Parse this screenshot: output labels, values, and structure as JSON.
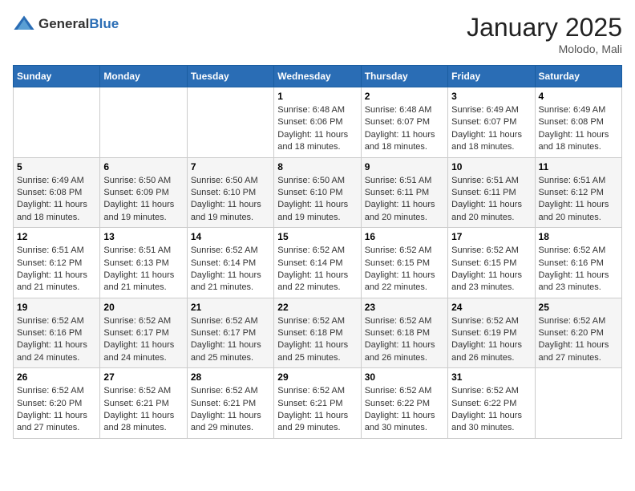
{
  "header": {
    "logo_general": "General",
    "logo_blue": "Blue",
    "month_year": "January 2025",
    "location": "Molodo, Mali"
  },
  "days_of_week": [
    "Sunday",
    "Monday",
    "Tuesday",
    "Wednesday",
    "Thursday",
    "Friday",
    "Saturday"
  ],
  "weeks": [
    [
      {
        "day": "",
        "sunrise": "",
        "sunset": "",
        "daylight": ""
      },
      {
        "day": "",
        "sunrise": "",
        "sunset": "",
        "daylight": ""
      },
      {
        "day": "",
        "sunrise": "",
        "sunset": "",
        "daylight": ""
      },
      {
        "day": "1",
        "sunrise": "Sunrise: 6:48 AM",
        "sunset": "Sunset: 6:06 PM",
        "daylight": "Daylight: 11 hours and 18 minutes."
      },
      {
        "day": "2",
        "sunrise": "Sunrise: 6:48 AM",
        "sunset": "Sunset: 6:07 PM",
        "daylight": "Daylight: 11 hours and 18 minutes."
      },
      {
        "day": "3",
        "sunrise": "Sunrise: 6:49 AM",
        "sunset": "Sunset: 6:07 PM",
        "daylight": "Daylight: 11 hours and 18 minutes."
      },
      {
        "day": "4",
        "sunrise": "Sunrise: 6:49 AM",
        "sunset": "Sunset: 6:08 PM",
        "daylight": "Daylight: 11 hours and 18 minutes."
      }
    ],
    [
      {
        "day": "5",
        "sunrise": "Sunrise: 6:49 AM",
        "sunset": "Sunset: 6:08 PM",
        "daylight": "Daylight: 11 hours and 18 minutes."
      },
      {
        "day": "6",
        "sunrise": "Sunrise: 6:50 AM",
        "sunset": "Sunset: 6:09 PM",
        "daylight": "Daylight: 11 hours and 19 minutes."
      },
      {
        "day": "7",
        "sunrise": "Sunrise: 6:50 AM",
        "sunset": "Sunset: 6:10 PM",
        "daylight": "Daylight: 11 hours and 19 minutes."
      },
      {
        "day": "8",
        "sunrise": "Sunrise: 6:50 AM",
        "sunset": "Sunset: 6:10 PM",
        "daylight": "Daylight: 11 hours and 19 minutes."
      },
      {
        "day": "9",
        "sunrise": "Sunrise: 6:51 AM",
        "sunset": "Sunset: 6:11 PM",
        "daylight": "Daylight: 11 hours and 20 minutes."
      },
      {
        "day": "10",
        "sunrise": "Sunrise: 6:51 AM",
        "sunset": "Sunset: 6:11 PM",
        "daylight": "Daylight: 11 hours and 20 minutes."
      },
      {
        "day": "11",
        "sunrise": "Sunrise: 6:51 AM",
        "sunset": "Sunset: 6:12 PM",
        "daylight": "Daylight: 11 hours and 20 minutes."
      }
    ],
    [
      {
        "day": "12",
        "sunrise": "Sunrise: 6:51 AM",
        "sunset": "Sunset: 6:12 PM",
        "daylight": "Daylight: 11 hours and 21 minutes."
      },
      {
        "day": "13",
        "sunrise": "Sunrise: 6:51 AM",
        "sunset": "Sunset: 6:13 PM",
        "daylight": "Daylight: 11 hours and 21 minutes."
      },
      {
        "day": "14",
        "sunrise": "Sunrise: 6:52 AM",
        "sunset": "Sunset: 6:14 PM",
        "daylight": "Daylight: 11 hours and 21 minutes."
      },
      {
        "day": "15",
        "sunrise": "Sunrise: 6:52 AM",
        "sunset": "Sunset: 6:14 PM",
        "daylight": "Daylight: 11 hours and 22 minutes."
      },
      {
        "day": "16",
        "sunrise": "Sunrise: 6:52 AM",
        "sunset": "Sunset: 6:15 PM",
        "daylight": "Daylight: 11 hours and 22 minutes."
      },
      {
        "day": "17",
        "sunrise": "Sunrise: 6:52 AM",
        "sunset": "Sunset: 6:15 PM",
        "daylight": "Daylight: 11 hours and 23 minutes."
      },
      {
        "day": "18",
        "sunrise": "Sunrise: 6:52 AM",
        "sunset": "Sunset: 6:16 PM",
        "daylight": "Daylight: 11 hours and 23 minutes."
      }
    ],
    [
      {
        "day": "19",
        "sunrise": "Sunrise: 6:52 AM",
        "sunset": "Sunset: 6:16 PM",
        "daylight": "Daylight: 11 hours and 24 minutes."
      },
      {
        "day": "20",
        "sunrise": "Sunrise: 6:52 AM",
        "sunset": "Sunset: 6:17 PM",
        "daylight": "Daylight: 11 hours and 24 minutes."
      },
      {
        "day": "21",
        "sunrise": "Sunrise: 6:52 AM",
        "sunset": "Sunset: 6:17 PM",
        "daylight": "Daylight: 11 hours and 25 minutes."
      },
      {
        "day": "22",
        "sunrise": "Sunrise: 6:52 AM",
        "sunset": "Sunset: 6:18 PM",
        "daylight": "Daylight: 11 hours and 25 minutes."
      },
      {
        "day": "23",
        "sunrise": "Sunrise: 6:52 AM",
        "sunset": "Sunset: 6:18 PM",
        "daylight": "Daylight: 11 hours and 26 minutes."
      },
      {
        "day": "24",
        "sunrise": "Sunrise: 6:52 AM",
        "sunset": "Sunset: 6:19 PM",
        "daylight": "Daylight: 11 hours and 26 minutes."
      },
      {
        "day": "25",
        "sunrise": "Sunrise: 6:52 AM",
        "sunset": "Sunset: 6:20 PM",
        "daylight": "Daylight: 11 hours and 27 minutes."
      }
    ],
    [
      {
        "day": "26",
        "sunrise": "Sunrise: 6:52 AM",
        "sunset": "Sunset: 6:20 PM",
        "daylight": "Daylight: 11 hours and 27 minutes."
      },
      {
        "day": "27",
        "sunrise": "Sunrise: 6:52 AM",
        "sunset": "Sunset: 6:21 PM",
        "daylight": "Daylight: 11 hours and 28 minutes."
      },
      {
        "day": "28",
        "sunrise": "Sunrise: 6:52 AM",
        "sunset": "Sunset: 6:21 PM",
        "daylight": "Daylight: 11 hours and 29 minutes."
      },
      {
        "day": "29",
        "sunrise": "Sunrise: 6:52 AM",
        "sunset": "Sunset: 6:21 PM",
        "daylight": "Daylight: 11 hours and 29 minutes."
      },
      {
        "day": "30",
        "sunrise": "Sunrise: 6:52 AM",
        "sunset": "Sunset: 6:22 PM",
        "daylight": "Daylight: 11 hours and 30 minutes."
      },
      {
        "day": "31",
        "sunrise": "Sunrise: 6:52 AM",
        "sunset": "Sunset: 6:22 PM",
        "daylight": "Daylight: 11 hours and 30 minutes."
      },
      {
        "day": "",
        "sunrise": "",
        "sunset": "",
        "daylight": ""
      }
    ]
  ]
}
